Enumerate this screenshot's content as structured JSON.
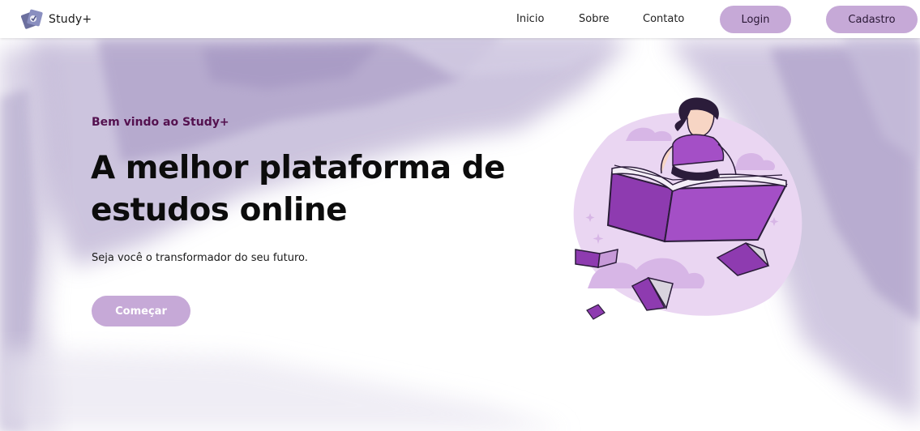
{
  "brand": {
    "name": "Study+",
    "logo_icon": "study-logo-icon"
  },
  "nav": {
    "links": [
      {
        "label": "Inicio"
      },
      {
        "label": "Sobre"
      },
      {
        "label": "Contato"
      }
    ],
    "login_label": "Login",
    "signup_label": "Cadastro"
  },
  "hero": {
    "eyebrow": "Bem vindo ao Study+",
    "title": "A melhor plataforma de estudos online",
    "subtitle": "Seja você o transformador do seu futuro.",
    "cta_label": "Começar",
    "illustration_icon": "woman-reading-flying-book-illustration"
  },
  "colors": {
    "accent": "#c6a9d7",
    "eyebrow": "#54114f",
    "illustration_purple": "#8e3bb0",
    "illustration_blob": "#e8d3f0"
  }
}
